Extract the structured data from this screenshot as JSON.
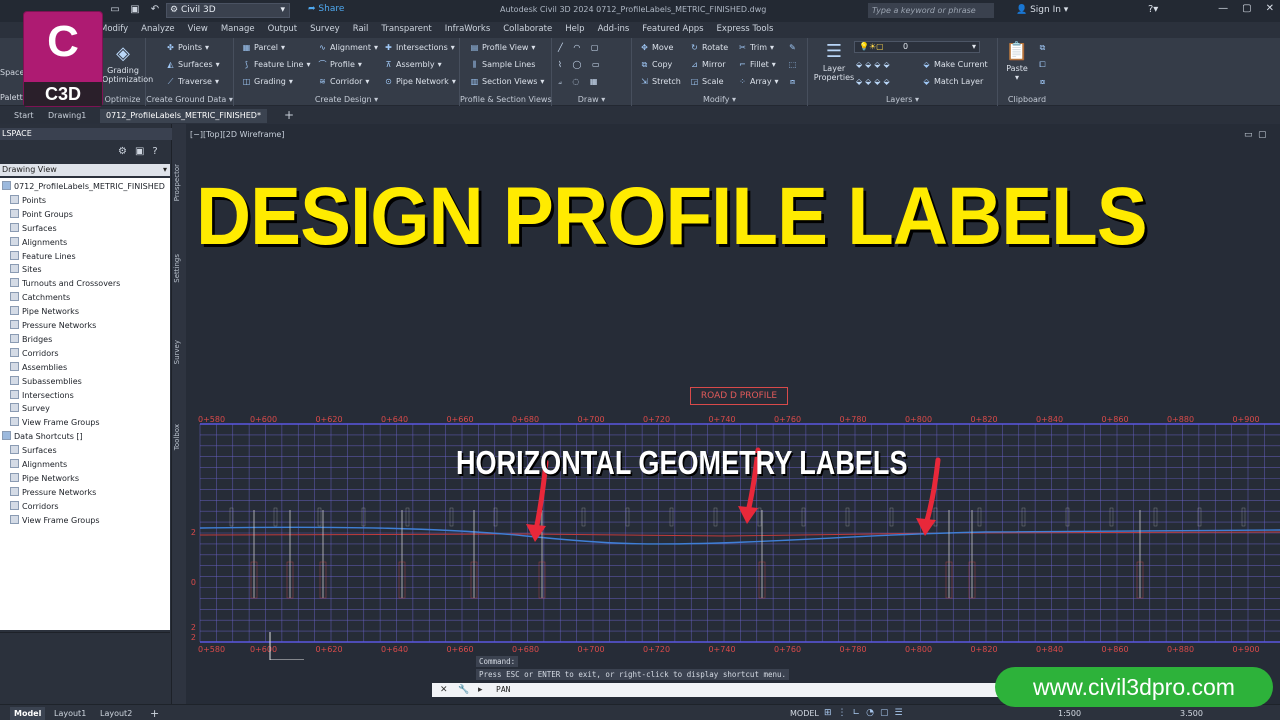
{
  "titlebar": {
    "workspace": "Civil 3D",
    "share_label": "Share",
    "app_title": "Autodesk Civil 3D 2024    0712_ProfileLabels_METRIC_FINISHED.dwg",
    "search_placeholder": "Type a keyword or phrase",
    "sign_in": "Sign In"
  },
  "logo": {
    "letter": "C",
    "label": "C3D"
  },
  "menu": [
    "Modify",
    "Analyze",
    "View",
    "Manage",
    "Output",
    "Survey",
    "Rail",
    "Transparent",
    "InfraWorks",
    "Collaborate",
    "Help",
    "Add-ins",
    "Featured Apps",
    "Express Tools"
  ],
  "ribbon": {
    "left_labels": {
      "space": "Space",
      "palettes": "Palettes"
    },
    "grading_opt": "Grading\nOptimization",
    "optimize": "Optimize",
    "ground": {
      "title": "Create Ground Data",
      "points": "Points",
      "surfaces": "Surfaces",
      "traverse": "Traverse"
    },
    "design": {
      "title": "Create Design",
      "parcel": "Parcel",
      "feature_line": "Feature Line",
      "grading": "Grading",
      "alignment": "Alignment",
      "profile": "Profile",
      "corridor": "Corridor",
      "intersections": "Intersections",
      "assembly": "Assembly",
      "pipe_network": "Pipe Network"
    },
    "profile_section": {
      "title": "Profile & Section Views",
      "profile_view": "Profile View",
      "sample_lines": "Sample Lines",
      "section_views": "Section Views"
    },
    "draw_title": "Draw",
    "modify": {
      "title": "Modify",
      "move": "Move",
      "rotate": "Rotate",
      "trim": "Trim",
      "copy": "Copy",
      "mirror": "Mirror",
      "fillet": "Fillet",
      "stretch": "Stretch",
      "scale": "Scale",
      "array": "Array"
    },
    "layers": {
      "title": "Layers",
      "layer_properties": "Layer\nProperties",
      "current_layer": "0",
      "make_current": "Make Current",
      "match_layer": "Match Layer"
    },
    "clipboard": {
      "title": "Clipboard",
      "paste": "Paste"
    }
  },
  "doctabs": {
    "start": "Start",
    "drawing1": "Drawing1",
    "active": "0712_ProfileLabels_METRIC_FINISHED*"
  },
  "toolspace": {
    "header": "LSPACE",
    "view_selector": "Drawing View",
    "root": "0712_ProfileLabels_METRIC_FINISHED",
    "items": [
      "Points",
      "Point Groups",
      "Surfaces",
      "Alignments",
      "Feature Lines",
      "Sites",
      "Turnouts and Crossovers",
      "Catchments",
      "Pipe Networks",
      "Pressure Networks",
      "Bridges",
      "Corridors",
      "Assemblies",
      "Subassemblies",
      "Intersections",
      "Survey",
      "View Frame Groups"
    ],
    "shortcuts_root": "Data Shortcuts []",
    "shortcuts": [
      "Surfaces",
      "Alignments",
      "Pipe Networks",
      "Pressure Networks",
      "Corridors",
      "View Frame Groups"
    ],
    "vtabs": [
      "Prospector",
      "Settings",
      "Survey",
      "Toolbox"
    ]
  },
  "viewport": {
    "label": "[−][Top][2D Wireframe]"
  },
  "overlay": {
    "headline": "DESIGN PROFILE LABELS",
    "subheadline": "HORIZONTAL GEOMETRY LABELS",
    "watermark": "www.civil3dpro.com"
  },
  "profile": {
    "title": "ROAD D PROFILE",
    "stations": [
      "0+580",
      "0+600",
      "0+620",
      "0+640",
      "0+660",
      "0+680",
      "0+700",
      "0+720",
      "0+740",
      "0+760",
      "0+780",
      "0+800",
      "0+820",
      "0+840",
      "0+860",
      "0+880",
      "0+900",
      "0+920",
      "0+940",
      "0+960"
    ],
    "elev_labels": [
      "2",
      "0",
      "2",
      "2"
    ],
    "line_color": "#3f7fd6",
    "grid_color": "#6a63c9",
    "label_color": "#d94a4a"
  },
  "command": {
    "line1": "Command:",
    "line2": "Press ESC or ENTER to exit, or right-click to display shortcut menu.",
    "current": "PAN"
  },
  "status": {
    "layouts": [
      "Model",
      "Layout1",
      "Layout2"
    ],
    "model": "MODEL",
    "scale": "1:500",
    "elevation": "3.500"
  }
}
